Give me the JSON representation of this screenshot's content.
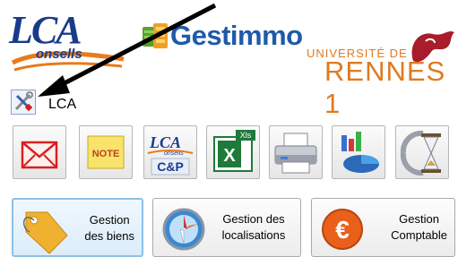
{
  "header": {
    "lca_logo": "LCA",
    "lca_logo_sub": "onsells",
    "app_name": "Gestimmo",
    "university_line1": "UNIVERSITÉ DE",
    "university_line2": "RENNES 1"
  },
  "user": {
    "name": "LCA",
    "tools_icon": "tools-icon"
  },
  "toolbar": {
    "buttons": [
      {
        "icon": "mail-icon"
      },
      {
        "icon": "note-icon",
        "text": "NOTE"
      },
      {
        "icon": "lca-cp-icon",
        "text_top": "LCA",
        "text_sub": "onsells",
        "text_bottom": "C&P"
      },
      {
        "icon": "excel-icon",
        "text": "X",
        "badge": "Xls"
      },
      {
        "icon": "printer-icon"
      },
      {
        "icon": "charts-icon"
      },
      {
        "icon": "hourglass-icon"
      }
    ]
  },
  "modules": [
    {
      "line1": "Gestion",
      "line2": "des biens",
      "icon": "tag-icon",
      "selected": true
    },
    {
      "line1": "Gestion des",
      "line2": "localisations",
      "icon": "compass-icon",
      "selected": false
    },
    {
      "line1": "Gestion",
      "line2": "Comptable",
      "icon": "euro-icon",
      "selected": false
    }
  ],
  "colors": {
    "lca_blue": "#1a3b8c",
    "gestimmo_blue": "#1f5aa8",
    "rennes_orange": "#e07a20",
    "selected_border": "#8cc0e8"
  }
}
